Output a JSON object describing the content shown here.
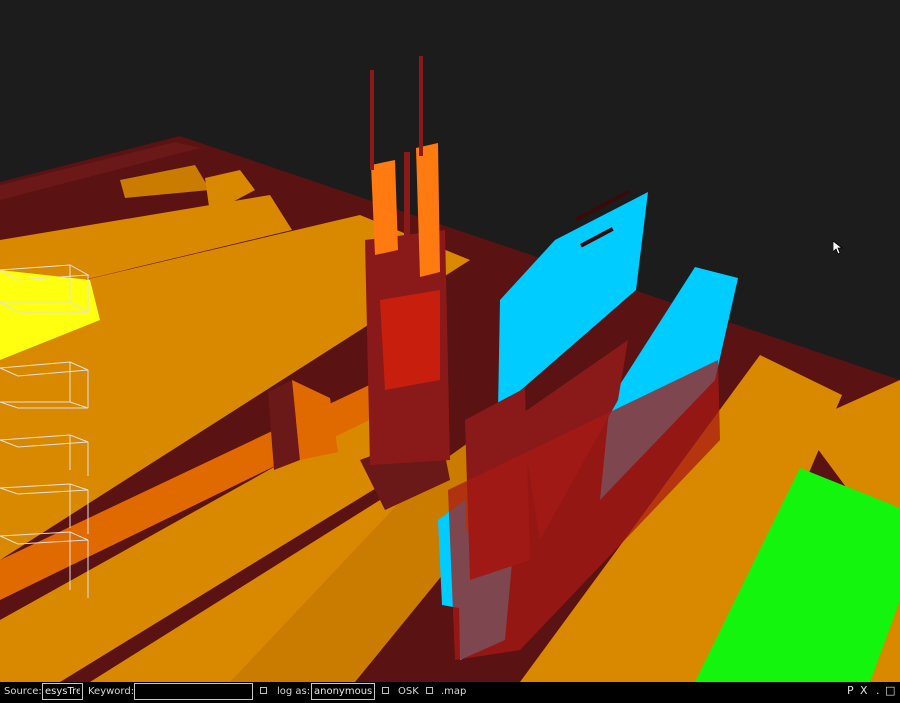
{
  "statusbar": {
    "source_label": "Source:",
    "source_value": "esysTree",
    "keyword_label": "Keyword:",
    "keyword_value": "",
    "login_label": "log as:",
    "login_value": "anonymous",
    "osk_label": "OSK",
    "map_label": ".map",
    "controls": {
      "pin": "P",
      "close": "X",
      "minimize": ".",
      "window": "□"
    }
  },
  "scene": {
    "description_icons": [
      "cursor-arrow-icon",
      "wireframe-box-icon"
    ],
    "colors": {
      "background": "#1c1c1c",
      "ground": "#5a1212",
      "platform": "#d98900",
      "tower": "#ff7a10",
      "highlight_blue": "#00ccff",
      "highlight_green": "#14f50e",
      "highlight_yellow": "#ffff10"
    }
  }
}
